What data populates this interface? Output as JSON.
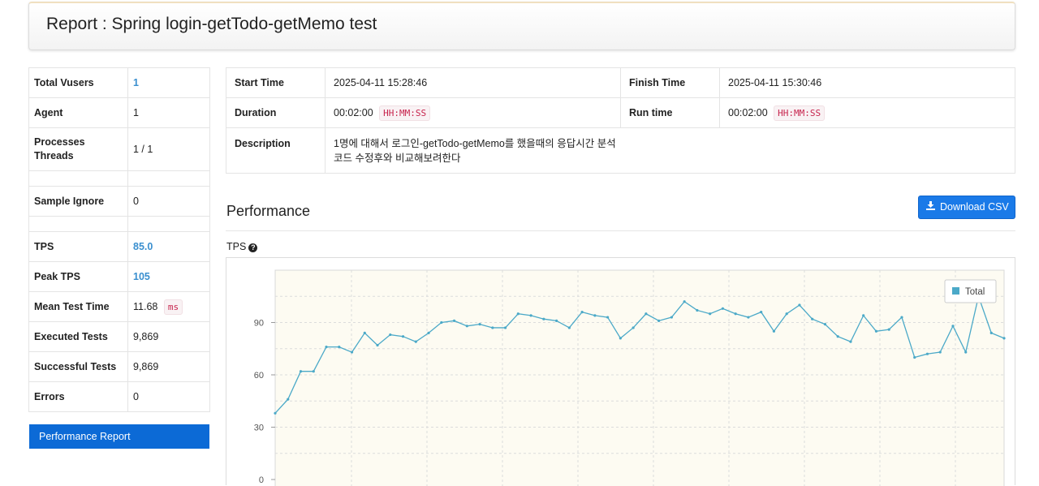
{
  "header": {
    "title": "Report : Spring login-getTodo-getMemo test"
  },
  "summary": {
    "total_vusers_label": "Total Vusers",
    "total_vusers": "1",
    "agent_label": "Agent",
    "agent": "1",
    "processes_label": "Processes",
    "threads_label": "Threads",
    "processes_threads": "1 / 1",
    "sample_ignore_label": "Sample Ignore",
    "sample_ignore": "0",
    "tps_label": "TPS",
    "tps": "85.0",
    "peak_tps_label": "Peak TPS",
    "peak_tps": "105",
    "mean_test_time_label": "Mean Test Time",
    "mean_test_time": "11.68",
    "mean_test_time_unit": "ms",
    "executed_tests_label": "Executed Tests",
    "executed_tests": "9,869",
    "successful_tests_label": "Successful Tests",
    "successful_tests": "9,869",
    "errors_label": "Errors",
    "errors": "0"
  },
  "nav": {
    "performance_report": "Performance Report"
  },
  "info": {
    "start_time_label": "Start Time",
    "start_time": "2025-04-11 15:28:46",
    "finish_time_label": "Finish Time",
    "finish_time": "2025-04-11 15:30:46",
    "duration_label": "Duration",
    "duration": "00:02:00",
    "duration_format": "HH:MM:SS",
    "run_time_label": "Run time",
    "run_time": "00:02:00",
    "run_time_format": "HH:MM:SS",
    "description_label": "Description",
    "description_line1": "1명에 대해서 로그인-getTodo-getMemo를 했을때의 응답시간 분석",
    "description_line2": "코드 수정후와 비교해보려한다"
  },
  "performance": {
    "title": "Performance",
    "download_csv": "Download CSV",
    "tps_chart_label": "TPS"
  },
  "chart_data": {
    "type": "line",
    "title": "",
    "xlabel": "",
    "ylabel": "",
    "ylim": [
      0,
      120
    ],
    "yticks": [
      0,
      30,
      60,
      90
    ],
    "grid": true,
    "legend_position": "top-right",
    "series": [
      {
        "name": "Total",
        "color": "#4ba9c8",
        "values": [
          38,
          46,
          62,
          62,
          76,
          76,
          73,
          84,
          77,
          83,
          82,
          79,
          84,
          90,
          91,
          88,
          89,
          87,
          87,
          95,
          94,
          92,
          91,
          87,
          96,
          94,
          93,
          81,
          87,
          95,
          91,
          93,
          102,
          97,
          95,
          98,
          95,
          93,
          96,
          85,
          95,
          100,
          92,
          89,
          82,
          79,
          94,
          85,
          86,
          93,
          70,
          72,
          73,
          88,
          73,
          105,
          84,
          81
        ]
      }
    ]
  }
}
